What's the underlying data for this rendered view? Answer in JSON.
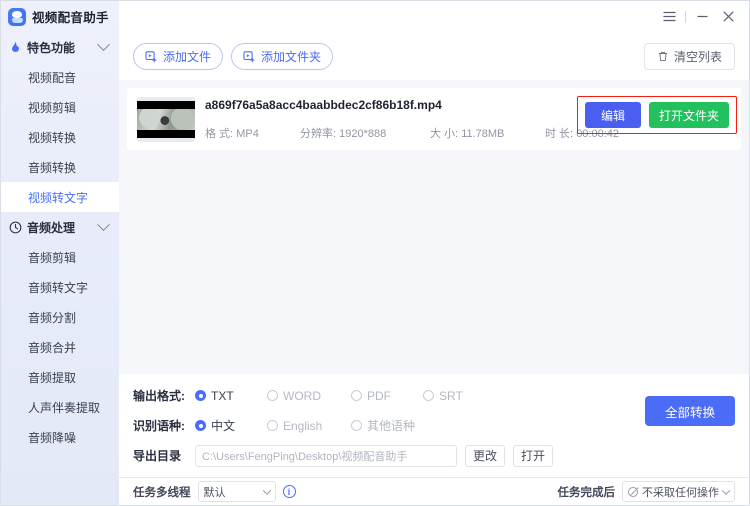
{
  "app": {
    "title": "视频配音助手",
    "logo_icon": "app-logo-icon"
  },
  "window": {
    "menu_icon": "hamburger-menu-icon",
    "minimize_icon": "minimize-icon",
    "close_icon": "close-icon"
  },
  "sidebar": {
    "groups": [
      {
        "label": "特色功能",
        "icon": "flame-icon",
        "chevron": "chevron-down-icon",
        "items": [
          {
            "label": "视频配音",
            "active": false
          },
          {
            "label": "视频剪辑",
            "active": false
          },
          {
            "label": "视频转换",
            "active": false
          },
          {
            "label": "音频转换",
            "active": false
          },
          {
            "label": "视频转文字",
            "active": true
          }
        ]
      },
      {
        "label": "音频处理",
        "icon": "clock-icon",
        "chevron": "chevron-down-icon",
        "items": [
          {
            "label": "音频剪辑",
            "active": false
          },
          {
            "label": "音频转文字",
            "active": false
          },
          {
            "label": "音频分割",
            "active": false
          },
          {
            "label": "音频合并",
            "active": false
          },
          {
            "label": "音频提取",
            "active": false
          },
          {
            "label": "人声伴奏提取",
            "active": false
          },
          {
            "label": "音频降噪",
            "active": false
          }
        ]
      }
    ]
  },
  "toolbar": {
    "add_file": "添加文件",
    "add_file_icon": "add-file-icon",
    "add_folder": "添加文件夹",
    "add_folder_icon": "add-folder-icon",
    "clear_list": "清空列表",
    "clear_list_icon": "trash-icon"
  },
  "file": {
    "name": "a869f76a5a8acc4baabbdec2cf86b18f.mp4",
    "format_label": "格 式:",
    "format_value": "MP4",
    "resolution_label": "分辨率:",
    "resolution_value": "1920*888",
    "size_label": "大 小:",
    "size_value": "11.78MB",
    "duration_label": "时 长:",
    "duration_value": "00:00:42",
    "edit_button": "编辑",
    "open_folder_button": "打开文件夹",
    "thumbnail_icon": "video-thumbnail"
  },
  "settings": {
    "output_format_label": "输出格式:",
    "output_formats": [
      {
        "label": "TXT",
        "selected": true
      },
      {
        "label": "WORD",
        "selected": false
      },
      {
        "label": "PDF",
        "selected": false
      },
      {
        "label": "SRT",
        "selected": false
      }
    ],
    "language_label": "识别语种:",
    "languages": [
      {
        "label": "中文",
        "selected": true
      },
      {
        "label": "English",
        "selected": false
      },
      {
        "label": "其他语种",
        "selected": false
      }
    ],
    "export_dir_label": "导出目录",
    "export_dir_value": "C:\\Users\\FengPing\\Desktop\\视频配音助手",
    "change_button": "更改",
    "open_button": "打开",
    "convert_all_button": "全部转换"
  },
  "status": {
    "threads_label": "任务多线程",
    "threads_value": "默认",
    "info_icon": "info-icon",
    "after_task_label": "任务完成后",
    "after_task_value": "不采取任何操作",
    "after_task_icon": "no-action-icon"
  },
  "colors": {
    "accent": "#4a6cf7",
    "edit_button": "#4a5ef0",
    "open_button": "#22c15e",
    "highlight": "#f41f10",
    "sidebar_bg": "#e8ecfa"
  }
}
